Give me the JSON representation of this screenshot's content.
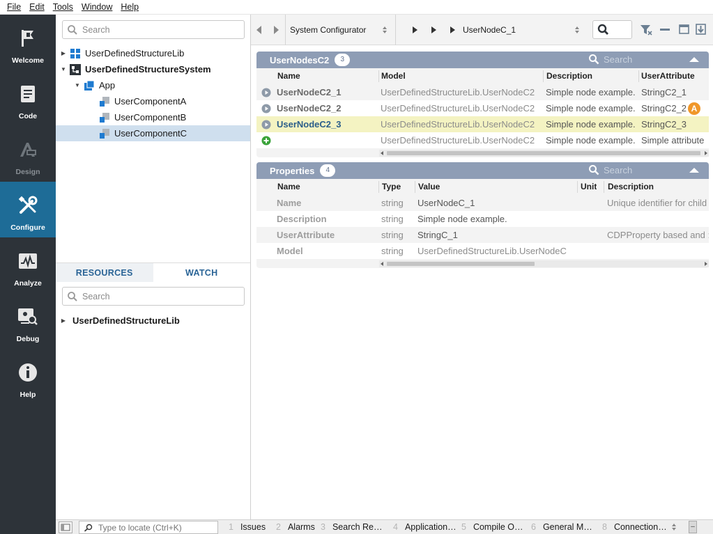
{
  "menubar": [
    "File",
    "Edit",
    "Tools",
    "Window",
    "Help"
  ],
  "nav": [
    {
      "label": "Welcome",
      "icon": "flag-icon"
    },
    {
      "label": "Code",
      "icon": "code-document-icon"
    },
    {
      "label": "Design",
      "icon": "design-icon"
    },
    {
      "label": "Configure",
      "icon": "configure-tools-icon"
    },
    {
      "label": "Analyze",
      "icon": "analyze-chart-icon"
    },
    {
      "label": "Debug",
      "icon": "debug-icon"
    },
    {
      "label": "Help",
      "icon": "info-icon"
    }
  ],
  "tree": {
    "search_placeholder": "Search",
    "items": [
      {
        "label": "UserDefinedStructureLib"
      },
      {
        "label": "UserDefinedStructureSystem"
      },
      {
        "label": "App"
      },
      {
        "label": "UserComponentA"
      },
      {
        "label": "UserComponentB"
      },
      {
        "label": "UserComponentC"
      }
    ]
  },
  "bottom_panel": {
    "tabs": [
      "RESOURCES",
      "WATCH"
    ],
    "search_placeholder": "Search",
    "items": [
      {
        "label": "UserDefinedStructureLib"
      }
    ]
  },
  "toolbar": {
    "context_select": "System Configurator",
    "breadcrumb_current": "UserNodeC_1"
  },
  "nodes_section": {
    "title": "UserNodesC2",
    "count": "3",
    "search_placeholder": "Search",
    "columns": [
      "Name",
      "Model",
      "Description",
      "UserAttribute"
    ],
    "rows": [
      {
        "name": "UserNodeC2_1",
        "model": "UserDefinedStructureLib.UserNodeC2",
        "description": "Simple node example.",
        "attribute": "StringC2_1"
      },
      {
        "name": "UserNodeC2_2",
        "model": "UserDefinedStructureLib.UserNodeC2",
        "description": "Simple node example.",
        "attribute": "StringC2_2",
        "badge": "A"
      },
      {
        "name": "UserNodeC2_3",
        "model": "UserDefinedStructureLib.UserNodeC2",
        "description": "Simple node example.",
        "attribute": "StringC2_3"
      }
    ],
    "new_row": {
      "model": "UserDefinedStructureLib.UserNodeC2",
      "description": "Simple node example.",
      "attribute": "Simple attribute"
    }
  },
  "properties_section": {
    "title": "Properties",
    "count": "4",
    "search_placeholder": "Search",
    "columns": [
      "Name",
      "Type",
      "Value",
      "Unit",
      "Description"
    ],
    "rows": [
      {
        "name": "Name",
        "type": "string",
        "value": "UserNodeC_1",
        "unit": "",
        "description": "Unique identifier for child"
      },
      {
        "name": "Description",
        "type": "string",
        "value": "Simple node example.",
        "unit": "",
        "description": ""
      },
      {
        "name": "UserAttribute",
        "type": "string",
        "value": "StringC_1",
        "unit": "",
        "description": "CDPProperty based and :"
      },
      {
        "name": "Model",
        "type": "string",
        "value": "UserDefinedStructureLib.UserNodeC",
        "unit": "",
        "description": ""
      }
    ]
  },
  "statusbar": {
    "locate_placeholder": "Type to locate (Ctrl+K)",
    "tabs": [
      {
        "num": "1",
        "label": "Issues"
      },
      {
        "num": "2",
        "label": "Alarms"
      },
      {
        "num": "3",
        "label": "Search Re…"
      },
      {
        "num": "4",
        "label": "Application…"
      },
      {
        "num": "5",
        "label": "Compile O…"
      },
      {
        "num": "6",
        "label": "General M…"
      },
      {
        "num": "8",
        "label": "Connection…"
      }
    ]
  },
  "colors": {
    "nav_bg": "#2d3339",
    "nav_active": "#1e6c97",
    "section_header": "#8e9db5",
    "selected_row": "#f4f3c2",
    "tree_selected": "#cfdfee",
    "badge_orange": "#f0972a",
    "add_green": "#3aa33a"
  }
}
